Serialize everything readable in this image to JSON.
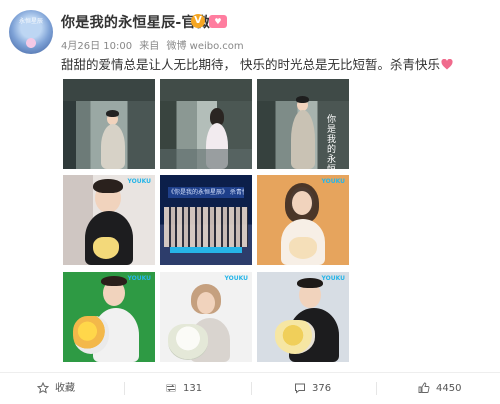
{
  "post": {
    "author": "你是我的永恒星辰-官微",
    "avatar_caption": "永恒星辰",
    "verified_icon": "V",
    "level_icon": "heart-badge",
    "date": "4月26日 10:00",
    "source_prefix": "来自",
    "source": "微博 weibo.com",
    "text": "甜甜的爱情总是让人无比期待，  快乐的时光总是无比短暂。杀青快乐",
    "heart_color": "#f06a8c"
  },
  "images": [
    {
      "name": "still-man-in-corridor",
      "watermark": ""
    },
    {
      "name": "still-woman-in-corridor",
      "watermark": ""
    },
    {
      "name": "still-man-with-title",
      "watermark": "",
      "title_overlay": "你是我的永恒星辰"
    },
    {
      "name": "actor-with-bouquet",
      "watermark": "YOUKU"
    },
    {
      "name": "cast-group-photo",
      "watermark": "",
      "banner": "《你是我的永恒星辰》 杀青快乐"
    },
    {
      "name": "actress-with-bouquet",
      "watermark": "YOUKU"
    },
    {
      "name": "actor-green-bg-bouquet",
      "watermark": "YOUKU"
    },
    {
      "name": "actress-white-bg-bouquet",
      "watermark": "YOUKU"
    },
    {
      "name": "actor-black-coat-bouquet",
      "watermark": "YOUKU"
    }
  ],
  "actions": {
    "favorite_label": "收藏",
    "repost_count": "131",
    "comment_count": "376",
    "like_count": "4450"
  }
}
